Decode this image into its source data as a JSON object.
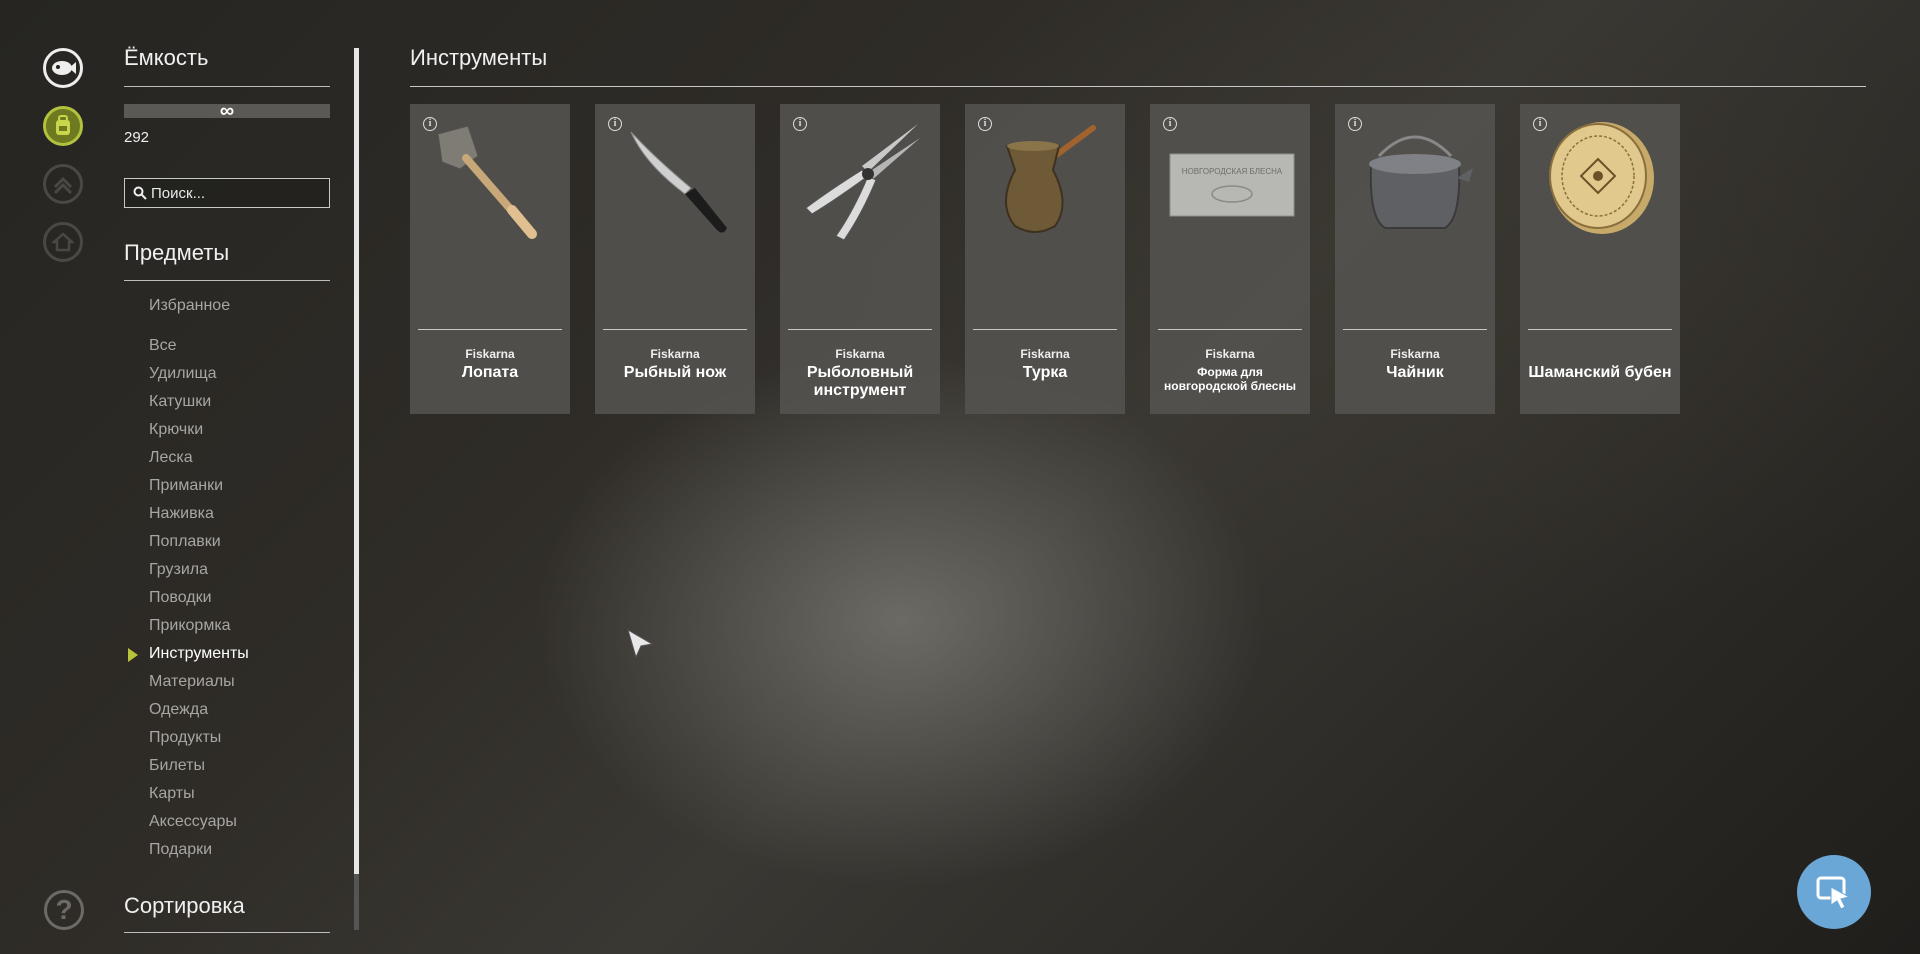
{
  "capacity": {
    "title": "Ёмкость",
    "limit": "∞",
    "count": "292"
  },
  "search": {
    "placeholder": "Поиск..."
  },
  "items_section": {
    "title": "Предметы",
    "favorites": "Избранное",
    "categories": [
      "Все",
      "Удилища",
      "Катушки",
      "Крючки",
      "Леска",
      "Приманки",
      "Наживка",
      "Поплавки",
      "Грузила",
      "Поводки",
      "Прикормка",
      "Инструменты",
      "Материалы",
      "Одежда",
      "Продукты",
      "Билеты",
      "Карты",
      "Аксессуары",
      "Подарки"
    ],
    "active_category": "Инструменты"
  },
  "sort_section": {
    "title": "Сортировка"
  },
  "main": {
    "title": "Инструменты",
    "cards": [
      {
        "brand": "Fiskarna",
        "name": "Лопата",
        "icon": "shovel-icon"
      },
      {
        "brand": "Fiskarna",
        "name": "Рыбный нож",
        "icon": "knife-icon"
      },
      {
        "brand": "Fiskarna",
        "name": "Рыболовный инструмент",
        "icon": "pliers-icon"
      },
      {
        "brand": "Fiskarna",
        "name": "Турка",
        "icon": "turka-icon"
      },
      {
        "brand": "Fiskarna",
        "name": "Форма для новгородской блесны",
        "icon": "mold-icon",
        "mold_text": "НОВГОРОДСКАЯ БЛЕСНА"
      },
      {
        "brand": "Fiskarna",
        "name": "Чайник",
        "icon": "kettle-icon"
      },
      {
        "brand": "",
        "name": "Шаманский бубен",
        "icon": "drum-icon"
      }
    ]
  },
  "rail": {
    "help": "?"
  },
  "colors": {
    "accent": "#b7c43a",
    "fab": "#6aa6d6",
    "card": "#54534f"
  }
}
